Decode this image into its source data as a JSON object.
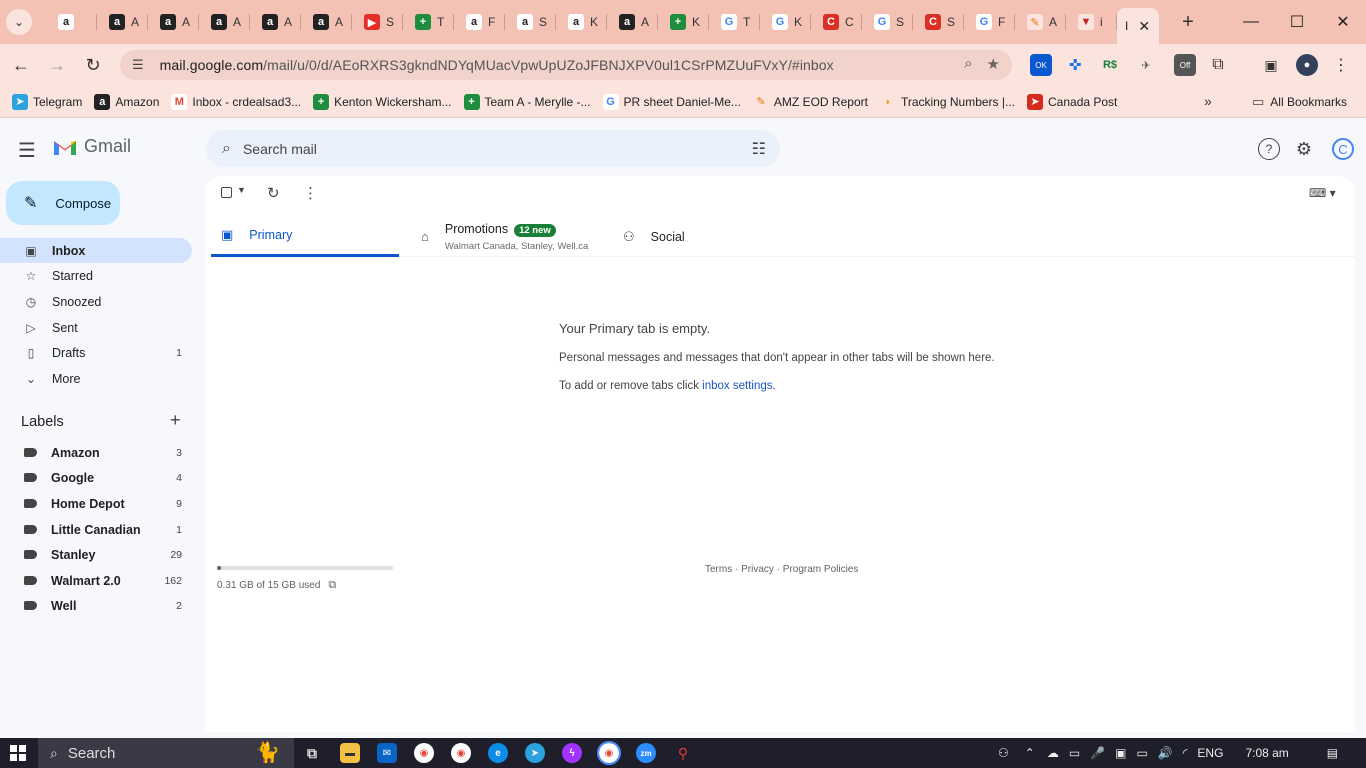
{
  "browser": {
    "pinned_tabs": [
      {
        "icon": "amazon-icon",
        "glyph": "a",
        "color": "#ffffff",
        "fg": "#222222",
        "label": ""
      },
      {
        "icon": "amazon-icon",
        "glyph": "a",
        "color": "#222222",
        "fg": "#ffffff",
        "label": "A"
      },
      {
        "icon": "amazon-icon",
        "glyph": "a",
        "color": "#222222",
        "fg": "#ffffff",
        "label": "A"
      },
      {
        "icon": "amazon-icon",
        "glyph": "a",
        "color": "#222222",
        "fg": "#ffffff",
        "label": "A"
      },
      {
        "icon": "amazon-icon",
        "glyph": "a",
        "color": "#222222",
        "fg": "#ffffff",
        "label": "A"
      },
      {
        "icon": "amazon-icon",
        "glyph": "a",
        "color": "#222222",
        "fg": "#ffffff",
        "label": "A"
      },
      {
        "icon": "youtube-icon",
        "glyph": "▶",
        "color": "#e52d27",
        "fg": "#ffffff",
        "label": "S"
      },
      {
        "icon": "sheets-icon",
        "glyph": "+",
        "color": "#1e8e3e",
        "fg": "#ffffff",
        "label": "T"
      },
      {
        "icon": "amazon-icon",
        "glyph": "a",
        "color": "#ffffff",
        "fg": "#222222",
        "label": "F"
      },
      {
        "icon": "amazon-icon",
        "glyph": "a",
        "color": "#ffffff",
        "fg": "#222222",
        "label": "S"
      },
      {
        "icon": "amazon-icon",
        "glyph": "a",
        "color": "#ffffff",
        "fg": "#222222",
        "label": "K"
      },
      {
        "icon": "amazon-icon",
        "glyph": "a",
        "color": "#222222",
        "fg": "#ffffff",
        "label": "A"
      },
      {
        "icon": "sheets-icon",
        "glyph": "+",
        "color": "#1e8e3e",
        "fg": "#ffffff",
        "label": "K"
      },
      {
        "icon": "google-icon",
        "glyph": "G",
        "color": "#ffffff",
        "fg": "#4285f4",
        "label": "T"
      },
      {
        "icon": "google-icon",
        "glyph": "G",
        "color": "#ffffff",
        "fg": "#4285f4",
        "label": "K"
      },
      {
        "icon": "capital-icon",
        "glyph": "C",
        "color": "#d93025",
        "fg": "#ffffff",
        "label": "C"
      },
      {
        "icon": "google-icon",
        "glyph": "G",
        "color": "#ffffff",
        "fg": "#4285f4",
        "label": "S"
      },
      {
        "icon": "capital-icon",
        "glyph": "C",
        "color": "#d93025",
        "fg": "#ffffff",
        "label": "S"
      },
      {
        "icon": "google-icon",
        "glyph": "G",
        "color": "#ffffff",
        "fg": "#4285f4",
        "label": "F"
      },
      {
        "icon": "tools-icon",
        "glyph": "✎",
        "color": "#fbe4dd",
        "fg": "#e8710a",
        "label": "A"
      },
      {
        "icon": "flag-icon",
        "glyph": "▼",
        "color": "#fbe4dd",
        "fg": "#c5221f",
        "label": "i"
      }
    ],
    "active_tab_label": "I",
    "url_host": "mail.google.com",
    "url_path": "/mail/u/0/d/AEoRXRS3gkndNDYqMUacVpwUpUZoJFBNJXPV0ul1CSrPMZUuFVxY/#inbox",
    "extension_badge": "OK",
    "extension_off": "Off",
    "bookmarks": [
      {
        "icon": "telegram-icon",
        "glyph": "➤",
        "color": "#2aa3df",
        "label": "Telegram"
      },
      {
        "icon": "amazon-icon",
        "glyph": "a",
        "color": "#222222",
        "label": "Amazon"
      },
      {
        "icon": "gmail-icon",
        "glyph": "M",
        "color": "#ffffff",
        "label": "Inbox - crdealsad3..."
      },
      {
        "icon": "sheets-icon",
        "glyph": "+",
        "color": "#1e8e3e",
        "label": "Kenton Wickersham..."
      },
      {
        "icon": "sheets-icon",
        "glyph": "+",
        "color": "#1e8e3e",
        "label": "Team A - Merylle -..."
      },
      {
        "icon": "google-icon",
        "glyph": "G",
        "color": "#ffffff",
        "label": "PR sheet Daniel-Me..."
      },
      {
        "icon": "tools-icon",
        "glyph": "✎",
        "color": "#fbe4dd",
        "label": "AMZ EOD Report"
      },
      {
        "icon": "taco-icon",
        "glyph": "◗",
        "color": "#fbe4dd",
        "label": "Tracking Numbers |..."
      },
      {
        "icon": "canada-post-icon",
        "glyph": "➤",
        "color": "#d52b1e",
        "label": "Canada Post"
      }
    ],
    "more_bookmarks": "»",
    "all_bookmarks": "All Bookmarks"
  },
  "gmail": {
    "brand": "Gmail",
    "search_placeholder": "Search mail",
    "compose_label": "Compose",
    "nav": [
      {
        "name": "inbox",
        "icon": "inbox-icon",
        "glyph": "▣",
        "label": "Inbox",
        "count": "",
        "active": true
      },
      {
        "name": "starred",
        "icon": "star-icon",
        "glyph": "☆",
        "label": "Starred",
        "count": ""
      },
      {
        "name": "snoozed",
        "icon": "clock-icon",
        "glyph": "◷",
        "label": "Snoozed",
        "count": ""
      },
      {
        "name": "sent",
        "icon": "send-icon",
        "glyph": "▷",
        "label": "Sent",
        "count": ""
      },
      {
        "name": "drafts",
        "icon": "draft-icon",
        "glyph": "▯",
        "label": "Drafts",
        "count": "1"
      },
      {
        "name": "more",
        "icon": "chevron-down-icon",
        "glyph": "⌄",
        "label": "More",
        "count": ""
      }
    ],
    "labels_heading": "Labels",
    "labels": [
      {
        "label": "Amazon",
        "count": "3"
      },
      {
        "label": "Google",
        "count": "4"
      },
      {
        "label": "Home Depot",
        "count": "9"
      },
      {
        "label": "Little Canadian",
        "count": "1"
      },
      {
        "label": "Stanley",
        "count": "29"
      },
      {
        "label": "Walmart 2.0",
        "count": "162"
      },
      {
        "label": "Well",
        "count": "2"
      }
    ],
    "tabs": {
      "primary": "Primary",
      "promotions": "Promotions",
      "promotions_badge": "12 new",
      "promotions_sub": "Walmart Canada, Stanley, Well.ca",
      "social": "Social"
    },
    "empty": {
      "title": "Your Primary tab is empty.",
      "message": "Personal messages and messages that don't appear in other tabs will be shown here.",
      "settings_prefix": "To add or remove tabs click ",
      "settings_link": "inbox settings",
      "settings_suffix": "."
    },
    "storage": {
      "used_text": "0.31 GB of 15 GB used",
      "used_fraction": 0.021
    },
    "footer": "Terms · Privacy · Program Policies"
  },
  "taskbar": {
    "search_label": "Search",
    "language": "ENG",
    "time": "7:08 am"
  }
}
